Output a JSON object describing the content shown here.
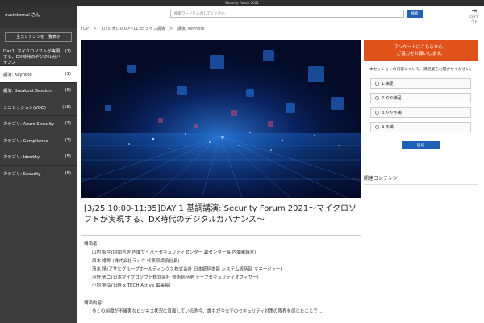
{
  "window": {
    "title": "Security Forum 2021"
  },
  "user": {
    "name": "evcinternal さん"
  },
  "sidebar": {
    "all_button": "全コンテンツを一覧表示",
    "items": [
      {
        "label": "Day1: マイクロソフトが実現する、DX時代のデジタルガバナンス",
        "count": "(7)"
      },
      {
        "label": "講演: Keynote",
        "count": "(1)"
      },
      {
        "label": "講演: Breakout Session",
        "count": "(6)"
      },
      {
        "label": "ミニセッション(VOD)",
        "count": "(16)"
      },
      {
        "label": "カテゴリ: Azure Security",
        "count": "(3)"
      },
      {
        "label": "カテゴリ: Compliance",
        "count": "(3)"
      },
      {
        "label": "カテゴリ: Identity",
        "count": "(5)"
      },
      {
        "label": "カテゴリ: Security",
        "count": "(8)"
      }
    ]
  },
  "search": {
    "placeholder": "検索ワードを入力してください",
    "button": "検索"
  },
  "header": {
    "logout": "ログアウト"
  },
  "breadcrumb": [
    "TOP",
    ">",
    "3/25(木)10:00〜11:35ライブ講演",
    ">",
    "講演: Keynote"
  ],
  "session": {
    "title": "[3/25 10:00-11:35]DAY 1 基調講演: Security Forum 2021〜マイクロソフトが実現する、DX時代のデジタルガバナンス〜",
    "speakers_label": "講演者：",
    "speakers": [
      "山内 智生(内閣官房 内閣サイバーセキュリティセンター 副センター長 内閣審議官)",
      "西本 逸郎 (株式会社ラック 代表取締役社長)",
      "清水 博(アサヒグループホールディングス株式会社 日本統括本部 システム統括部 マネージャー)",
      "河野 省二(日本マイクロソフト株式会社 技術統括室 チーフセキュリティオフィサー)",
      "小向 将弘(日経 x TECH Active 編集長)"
    ],
    "content_label": "講演内容：",
    "content_text": "多くの組織が不確実なビジネス状況に直面している昨今、誰もが今までのセキュリティ対策の限界を感じたことでし"
  },
  "survey": {
    "banner_line1": "アンケートはこちらから。",
    "banner_line2": "ご協力をお願いします。",
    "question": "本セッションの内容について、満足度をお聞かせください。",
    "options": [
      "1.満足",
      "2.やや満足",
      "3.やや不満",
      "4.不満"
    ],
    "submit": "送信"
  },
  "related": {
    "title": "関連コンテンツ"
  },
  "colors": {
    "accent": "#1f5fb5",
    "survey_banner": "#e0521a",
    "sidebar_bg": "#3d3d3d",
    "hero_bg": "#040a26"
  }
}
